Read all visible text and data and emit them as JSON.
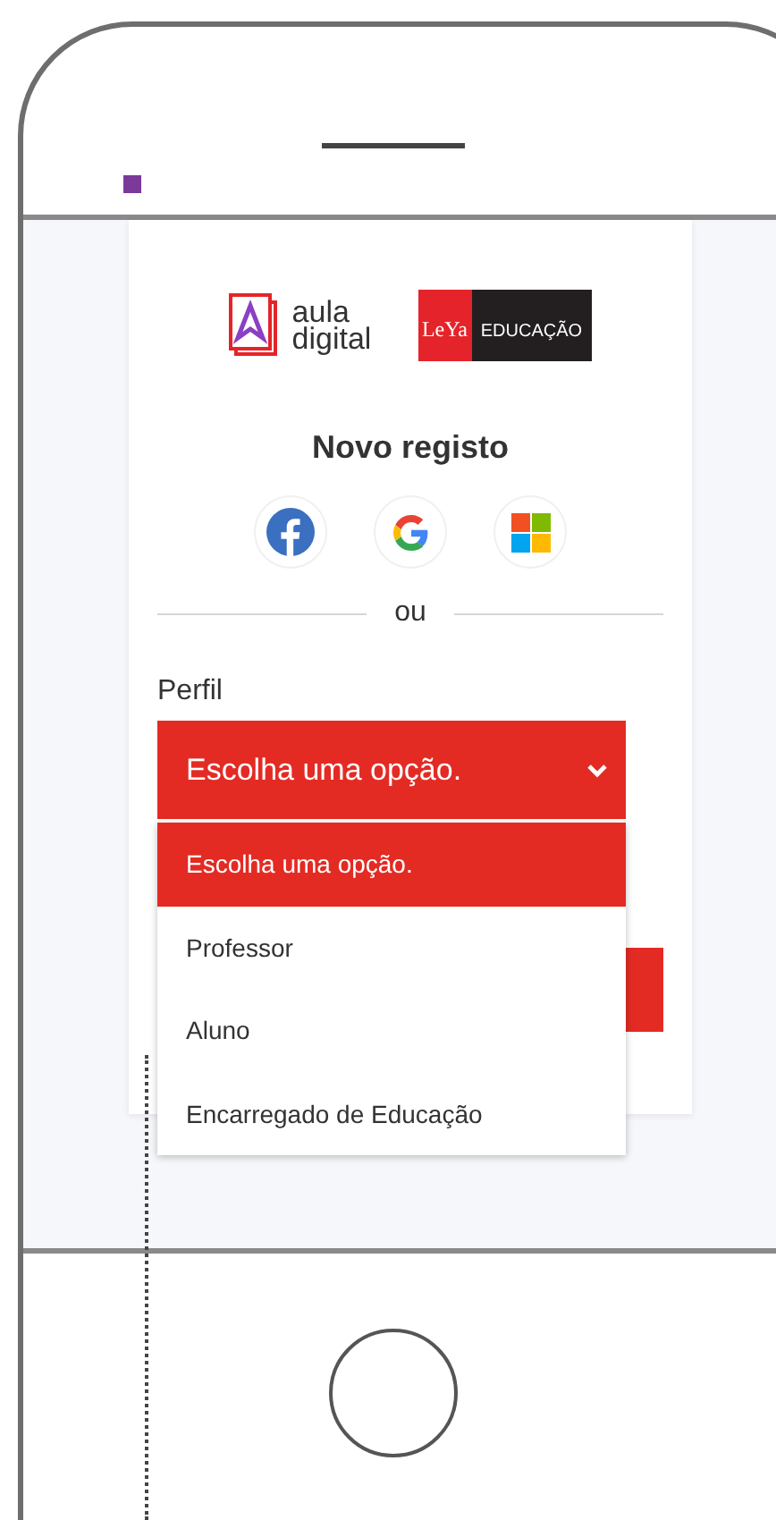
{
  "logos": {
    "aula_digital": {
      "line_1": "aula",
      "line_2": "digital"
    },
    "leya": {
      "brand": "LeYa",
      "label": "EDUCAÇÃO"
    }
  },
  "title": "Novo registo",
  "social_buttons": [
    {
      "kind": "facebook"
    },
    {
      "kind": "google"
    },
    {
      "kind": "microsoft"
    }
  ],
  "divider_text": "ou",
  "field": {
    "label": "Perfil",
    "value": "Escolha uma opção.",
    "expanded": true
  },
  "options": [
    {
      "label": "Escolha uma opção.",
      "selected": true
    },
    {
      "label": "Professor",
      "selected": false
    },
    {
      "label": "Aluno",
      "selected": false
    },
    {
      "label": "Encarregado de Educação",
      "selected": false
    }
  ]
}
